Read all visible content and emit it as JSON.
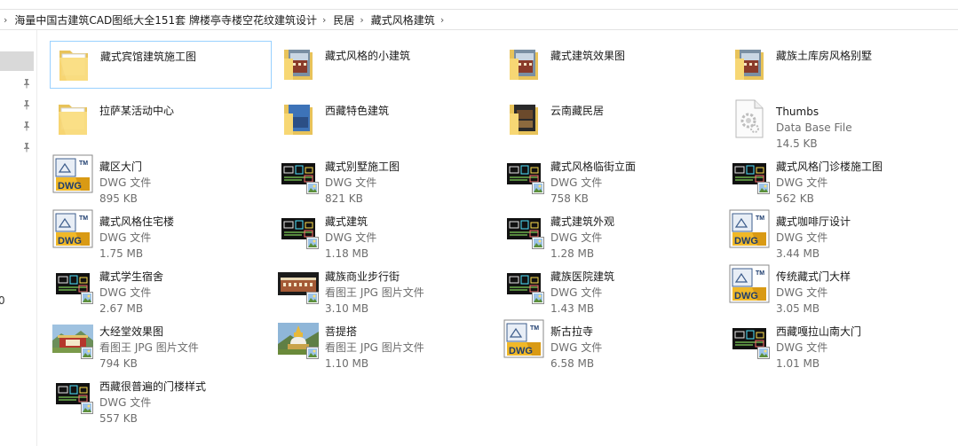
{
  "breadcrumb": [
    "海量中国古建筑CAD图纸大全151套 牌楼亭寺楼空花纹建筑设计",
    "民居",
    "藏式风格建筑"
  ],
  "nav": {
    "stray_text": "0"
  },
  "items": [
    {
      "name": "藏式宾馆建筑施工图",
      "kind": "folder",
      "thumb": "folder-plain",
      "selected": true
    },
    {
      "name": "藏式风格的小建筑",
      "kind": "folder",
      "thumb": "folder-photo"
    },
    {
      "name": "藏式建筑效果图",
      "kind": "folder",
      "thumb": "folder-photo"
    },
    {
      "name": "藏族土库房风格别墅",
      "kind": "folder",
      "thumb": "folder-photo"
    },
    {
      "name": "拉萨某活动中心",
      "kind": "folder",
      "thumb": "folder-plain"
    },
    {
      "name": "西藏特色建筑",
      "kind": "folder",
      "thumb": "folder-blue"
    },
    {
      "name": "云南藏民居",
      "kind": "folder",
      "thumb": "folder-dark"
    },
    {
      "name": "Thumbs",
      "type": "Data Base File",
      "size": "14.5 KB",
      "thumb": "gear-file"
    },
    {
      "name": "藏区大门",
      "type": "DWG 文件",
      "size": "895 KB",
      "thumb": "dwg"
    },
    {
      "name": "藏式别墅施工图",
      "type": "DWG 文件",
      "size": "821 KB",
      "thumb": "cad"
    },
    {
      "name": "藏式风格临街立面",
      "type": "DWG 文件",
      "size": "758 KB",
      "thumb": "cad"
    },
    {
      "name": "藏式风格门诊楼施工图",
      "type": "DWG 文件",
      "size": "562 KB",
      "thumb": "cad"
    },
    {
      "name": "藏式风格住宅楼",
      "type": "DWG 文件",
      "size": "1.75 MB",
      "thumb": "dwg"
    },
    {
      "name": "藏式建筑",
      "type": "DWG 文件",
      "size": "1.18 MB",
      "thumb": "cad"
    },
    {
      "name": "藏式建筑外观",
      "type": "DWG 文件",
      "size": "1.28 MB",
      "thumb": "cad"
    },
    {
      "name": "藏式咖啡厅设计",
      "type": "DWG 文件",
      "size": "3.44 MB",
      "thumb": "dwg"
    },
    {
      "name": "藏式学生宿舍",
      "type": "DWG 文件",
      "size": "2.67 MB",
      "thumb": "cad"
    },
    {
      "name": "藏族商业步行街",
      "type": "看图王 JPG 图片文件",
      "size": "3.10 MB",
      "thumb": "photo-street"
    },
    {
      "name": "藏族医院建筑",
      "type": "DWG 文件",
      "size": "1.43 MB",
      "thumb": "cad"
    },
    {
      "name": "传统藏式门大样",
      "type": "DWG 文件",
      "size": "3.05 MB",
      "thumb": "dwg"
    },
    {
      "name": "大经堂效果图",
      "type": "看图王 JPG 图片文件",
      "size": "794 KB",
      "thumb": "photo-temple"
    },
    {
      "name": "菩提搭",
      "type": "看图王 JPG 图片文件",
      "size": "1.10 MB",
      "thumb": "photo-stupa"
    },
    {
      "name": "斯古拉寺",
      "type": "DWG 文件",
      "size": "6.58 MB",
      "thumb": "dwg"
    },
    {
      "name": "西藏嘎拉山南大门",
      "type": "DWG 文件",
      "size": "1.01 MB",
      "thumb": "cad"
    },
    {
      "name": "西藏很普遍的门楼样式",
      "type": "DWG 文件",
      "size": "557 KB",
      "thumb": "cad"
    }
  ]
}
